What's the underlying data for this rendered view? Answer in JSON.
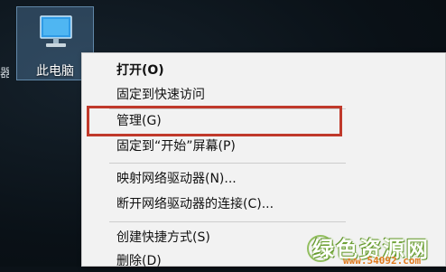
{
  "desktop": {
    "edge_label": "器",
    "icon": {
      "label": "此电脑",
      "icon_name": "computer-icon"
    }
  },
  "context_menu": {
    "items": [
      {
        "label": "打开(O)",
        "bold": true
      },
      {
        "label": "固定到快速访问"
      },
      {
        "label": "管理(G)",
        "highlighted": true
      },
      {
        "label": "固定到“开始”屏幕(P)"
      },
      {
        "label": "映射网络驱动器(N)..."
      },
      {
        "label": "断开网络驱动器的连接(C)..."
      },
      {
        "label": "创建快捷方式(S)"
      },
      {
        "label": "删除(D)"
      }
    ],
    "highlight_color": "#c0392b"
  },
  "watermark": {
    "brand": "绿色资源网",
    "url": "www.54092.com"
  }
}
